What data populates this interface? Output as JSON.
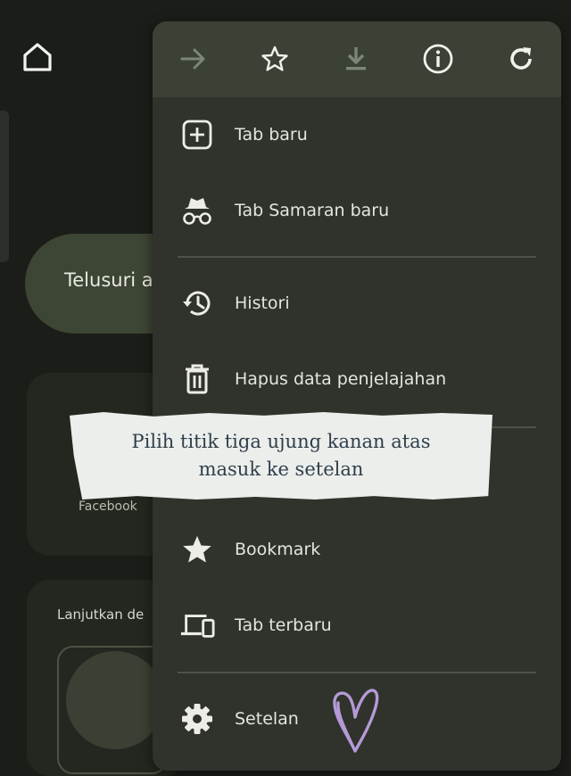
{
  "background": {
    "search_text": "Telusuri a",
    "shortcut_label": "Facebook",
    "continue_label": "Lanjutkan de"
  },
  "toolbar": {
    "icons": [
      "forward-icon",
      "star-icon",
      "download-icon",
      "info-icon",
      "reload-icon"
    ]
  },
  "menu": {
    "items": [
      {
        "label": "Tab baru",
        "icon": "new-tab-icon"
      },
      {
        "label": "Tab Samaran baru",
        "icon": "incognito-icon"
      },
      {
        "label": "Histori",
        "icon": "history-icon"
      },
      {
        "label": "Hapus data penjelajahan",
        "icon": "trash-icon"
      },
      {
        "label": "Bookmark",
        "icon": "star-filled-icon"
      },
      {
        "label": "Tab terbaru",
        "icon": "devices-icon"
      },
      {
        "label": "Setelan",
        "icon": "gear-icon"
      }
    ]
  },
  "note": {
    "line1": "Pilih titik tiga ujung kanan atas",
    "line2": "masuk ke setelan"
  },
  "colors": {
    "background": "#1b1d19",
    "menu": "#2f332c",
    "toolbar": "#3b4135",
    "accent_search": "#3d4534",
    "heart": "#b59ad6"
  }
}
